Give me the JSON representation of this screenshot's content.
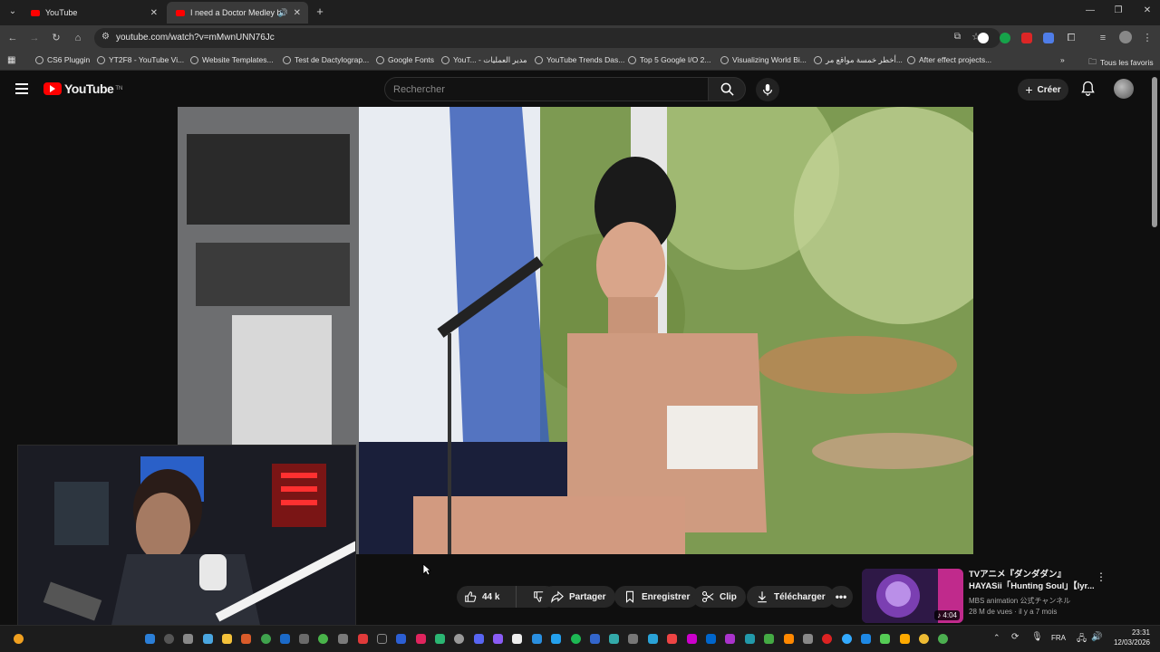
{
  "browser": {
    "tabs": [
      {
        "label": "YouTube",
        "active": false
      },
      {
        "label": "I need a Doctor Medley by",
        "active": true
      }
    ],
    "url": "youtube.com/watch?v=mMwnUNN76Jc",
    "bookmarks": [
      "CS6 Pluggin",
      "YT2F8 - YouTube Vi...",
      "Website Templates...",
      "Test de Dactylograp...",
      "Google Fonts",
      "YouT... - مدير العمليات",
      "YouTube Trends Das...",
      "Top 5 Google I/O 2...",
      "Visualizing World Bi...",
      "أخطر خمسة مواقع مر...",
      "After effect projects..."
    ],
    "all_bookmarks": "Tous les favoris"
  },
  "youtube": {
    "logo_text": "YouTube",
    "logo_sup": "TN",
    "search_placeholder": "Rechercher",
    "create_label": "Créer"
  },
  "actions": {
    "like_count": "44 k",
    "share": "Partager",
    "save": "Enregistrer",
    "clip": "Clip",
    "download": "Télécharger"
  },
  "suggestion": {
    "title": "TVアニメ『ダンダダン』HAYASii「Hunting Soul」【lyr...",
    "channel": "MBS animation 公式チャンネル",
    "meta": "28 M de vues · il y a 7 mois",
    "duration": "4:04"
  },
  "taskbar": {
    "lang": "FRA",
    "time": "23:31",
    "date": "12/03/2026"
  },
  "colors": {
    "bg": "#0f0f0f",
    "yt_red": "#ff0000",
    "pill": "#272727"
  }
}
